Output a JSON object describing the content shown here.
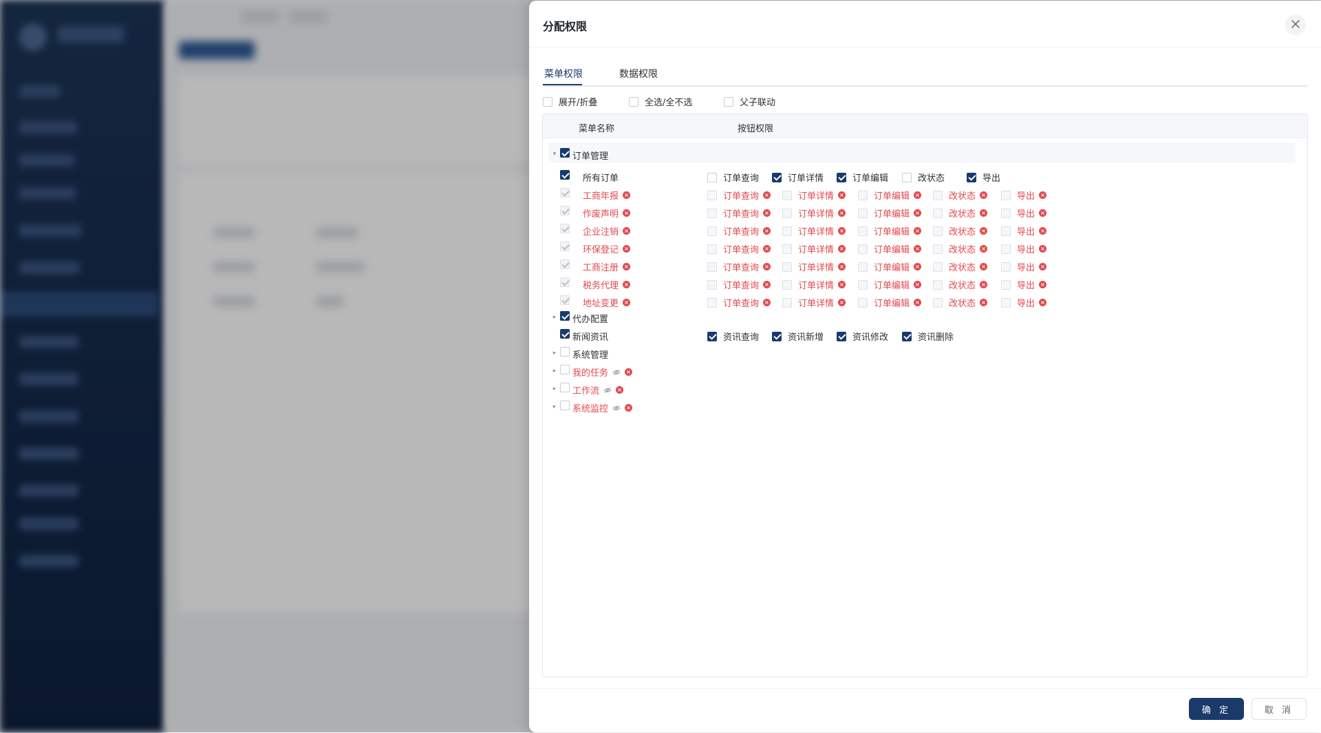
{
  "dialog": {
    "title": "分配权限",
    "close_icon": "close-icon",
    "tabs": [
      {
        "label": "菜单权限",
        "active": true
      },
      {
        "label": "数据权限",
        "active": false
      }
    ],
    "options": [
      {
        "label": "展开/折叠",
        "checked": false
      },
      {
        "label": "全选/全不选",
        "checked": false
      },
      {
        "label": "父子联动",
        "checked": false
      }
    ],
    "columns": {
      "menu": "菜单名称",
      "buttons": "按钮权限"
    },
    "tree": [
      {
        "label": "订单管理",
        "checked": true,
        "expanded": true,
        "level": 0,
        "red": false,
        "hidden": false,
        "error": false,
        "perms": []
      },
      {
        "label": "所有订单",
        "checked": true,
        "level": 1,
        "red": false,
        "disabled": false,
        "error": false,
        "perms": [
          {
            "label": "订单查询",
            "checked": false,
            "red": false
          },
          {
            "label": "订单详情",
            "checked": true,
            "red": false
          },
          {
            "label": "订单编辑",
            "checked": true,
            "red": false
          },
          {
            "label": "改状态",
            "checked": false,
            "red": false
          },
          {
            "label": "导出",
            "checked": true,
            "red": false
          }
        ]
      },
      {
        "label": "工商年报",
        "checked": true,
        "level": 1,
        "red": true,
        "disabled": true,
        "error": true,
        "perms": [
          {
            "label": "订单查询",
            "checked": false,
            "red": true
          },
          {
            "label": "订单详情",
            "checked": false,
            "red": true
          },
          {
            "label": "订单编辑",
            "checked": false,
            "red": true
          },
          {
            "label": "改状态",
            "checked": false,
            "red": true
          },
          {
            "label": "导出",
            "checked": false,
            "red": true
          }
        ]
      },
      {
        "label": "作废声明",
        "checked": true,
        "level": 1,
        "red": true,
        "disabled": true,
        "error": true,
        "perms": [
          {
            "label": "订单查询",
            "checked": false,
            "red": true
          },
          {
            "label": "订单详情",
            "checked": false,
            "red": true
          },
          {
            "label": "订单编辑",
            "checked": false,
            "red": true
          },
          {
            "label": "改状态",
            "checked": false,
            "red": true
          },
          {
            "label": "导出",
            "checked": false,
            "red": true
          }
        ]
      },
      {
        "label": "企业注销",
        "checked": true,
        "level": 1,
        "red": true,
        "disabled": true,
        "error": true,
        "perms": [
          {
            "label": "订单查询",
            "checked": false,
            "red": true
          },
          {
            "label": "订单详情",
            "checked": false,
            "red": true
          },
          {
            "label": "订单编辑",
            "checked": false,
            "red": true
          },
          {
            "label": "改状态",
            "checked": false,
            "red": true
          },
          {
            "label": "导出",
            "checked": false,
            "red": true
          }
        ]
      },
      {
        "label": "环保登记",
        "checked": true,
        "level": 1,
        "red": true,
        "disabled": true,
        "error": true,
        "perms": [
          {
            "label": "订单查询",
            "checked": false,
            "red": true
          },
          {
            "label": "订单详情",
            "checked": false,
            "red": true
          },
          {
            "label": "订单编辑",
            "checked": false,
            "red": true
          },
          {
            "label": "改状态",
            "checked": false,
            "red": true
          },
          {
            "label": "导出",
            "checked": false,
            "red": true
          }
        ]
      },
      {
        "label": "工商注册",
        "checked": true,
        "level": 1,
        "red": true,
        "disabled": true,
        "error": true,
        "perms": [
          {
            "label": "订单查询",
            "checked": false,
            "red": true
          },
          {
            "label": "订单详情",
            "checked": false,
            "red": true
          },
          {
            "label": "订单编辑",
            "checked": false,
            "red": true
          },
          {
            "label": "改状态",
            "checked": false,
            "red": true
          },
          {
            "label": "导出",
            "checked": false,
            "red": true
          }
        ]
      },
      {
        "label": "税务代理",
        "checked": true,
        "level": 1,
        "red": true,
        "disabled": true,
        "error": true,
        "perms": [
          {
            "label": "订单查询",
            "checked": false,
            "red": true
          },
          {
            "label": "订单详情",
            "checked": false,
            "red": true
          },
          {
            "label": "订单编辑",
            "checked": false,
            "red": true
          },
          {
            "label": "改状态",
            "checked": false,
            "red": true
          },
          {
            "label": "导出",
            "checked": false,
            "red": true
          }
        ]
      },
      {
        "label": "地址变更",
        "checked": true,
        "level": 1,
        "red": true,
        "disabled": true,
        "error": true,
        "perms": [
          {
            "label": "订单查询",
            "checked": false,
            "red": true
          },
          {
            "label": "订单详情",
            "checked": false,
            "red": true
          },
          {
            "label": "订单编辑",
            "checked": false,
            "red": true
          },
          {
            "label": "改状态",
            "checked": false,
            "red": true
          },
          {
            "label": "导出",
            "checked": false,
            "red": true
          }
        ]
      },
      {
        "label": "代办配置",
        "checked": true,
        "expandable": true,
        "level": 0,
        "red": false,
        "hidden": false,
        "error": false,
        "perms": []
      },
      {
        "label": "新闻资讯",
        "checked": true,
        "expandable": false,
        "level": 0,
        "red": false,
        "hidden": false,
        "error": false,
        "perms": [
          {
            "label": "资讯查询",
            "checked": true,
            "red": false
          },
          {
            "label": "资讯新增",
            "checked": true,
            "red": false
          },
          {
            "label": "资讯修改",
            "checked": true,
            "red": false
          },
          {
            "label": "资讯删除",
            "checked": true,
            "red": false
          }
        ]
      },
      {
        "label": "系统管理",
        "checked": false,
        "expandable": true,
        "level": 0,
        "red": false,
        "hidden": false,
        "error": false,
        "perms": []
      },
      {
        "label": "我的任务",
        "checked": false,
        "expandable": true,
        "level": 0,
        "red": true,
        "hidden": true,
        "error": true,
        "perms": []
      },
      {
        "label": "工作流",
        "checked": false,
        "expandable": true,
        "level": 0,
        "red": true,
        "hidden": true,
        "error": true,
        "perms": []
      },
      {
        "label": "系统监控",
        "checked": false,
        "expandable": true,
        "level": 0,
        "red": true,
        "hidden": true,
        "error": true,
        "perms": []
      }
    ],
    "footer": {
      "confirm": "确 定",
      "cancel": "取 消"
    }
  },
  "colors": {
    "accent": "#1a3a6b",
    "error": "#e5484d",
    "sidebar": "#142a4a"
  }
}
